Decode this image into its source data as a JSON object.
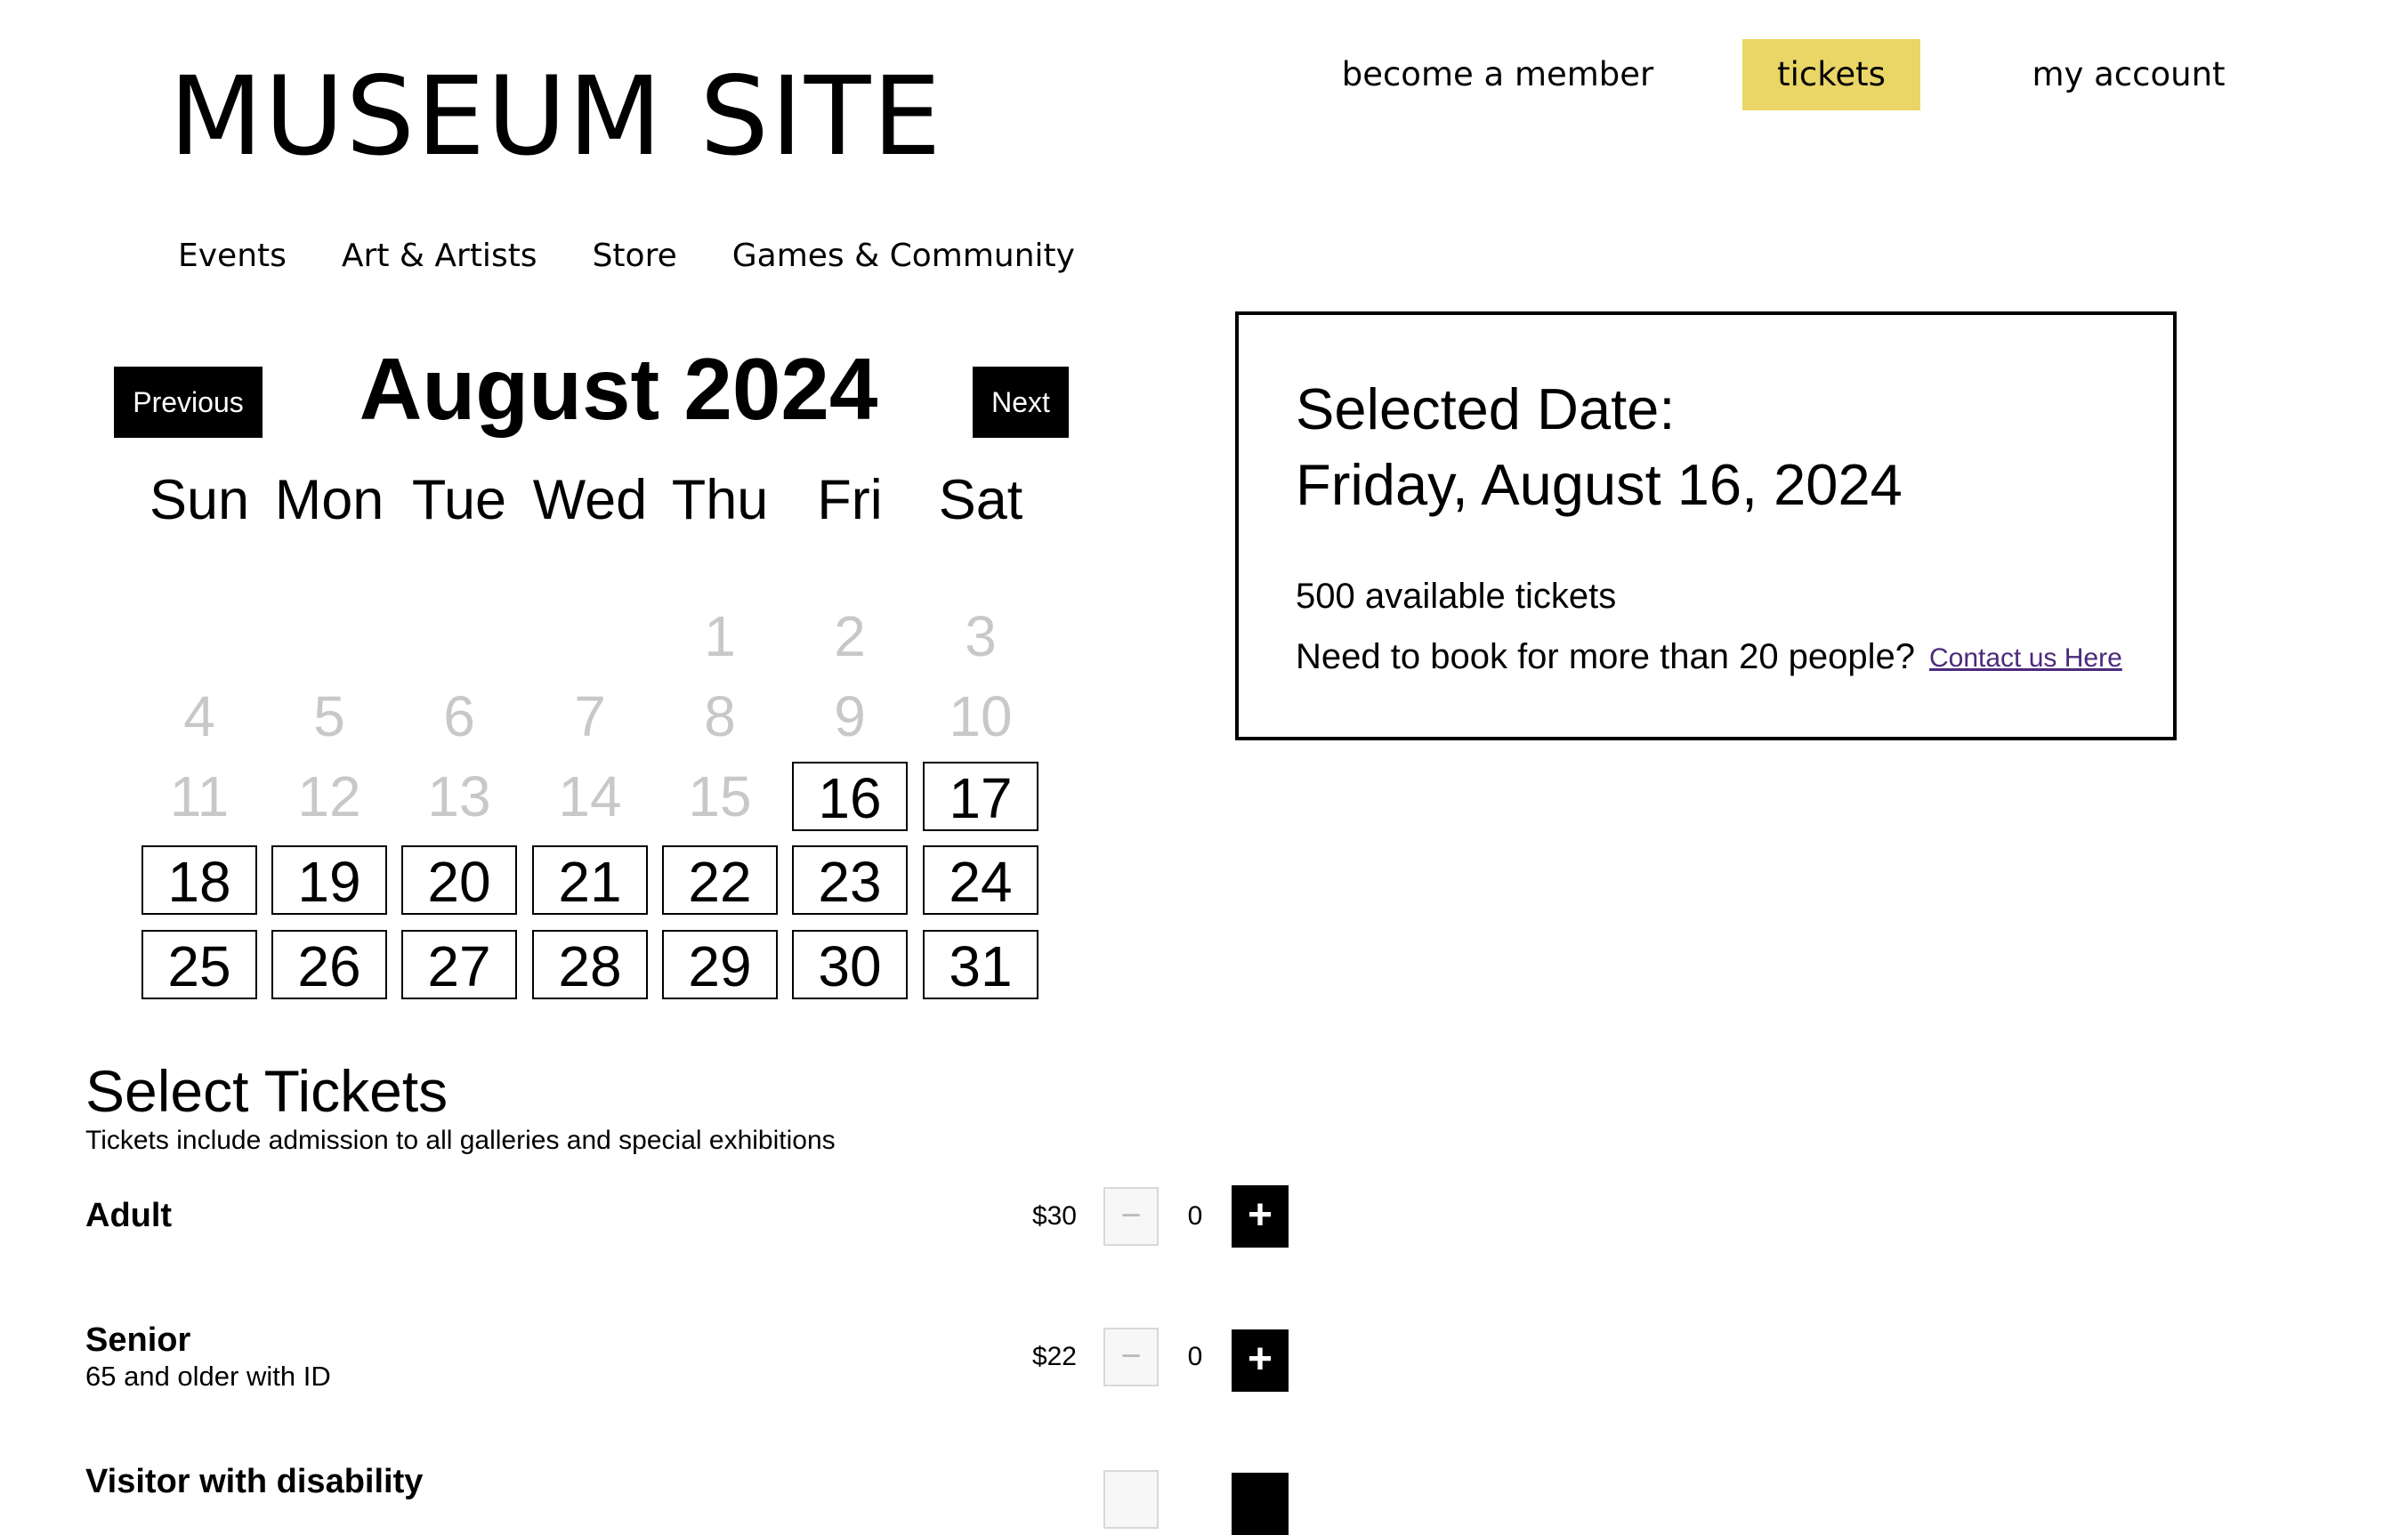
{
  "header": {
    "site_title": "MUSEUM SITE",
    "top_links": {
      "member": "become a member",
      "tickets": "tickets",
      "account": "my account"
    },
    "nav": [
      "Events",
      "Art & Artists",
      "Store",
      "Games & Community"
    ]
  },
  "calendar": {
    "prev_label": "Previous",
    "next_label": "Next",
    "month_title": "August 2024",
    "weekdays": [
      "Sun",
      "Mon",
      "Tue",
      "Wed",
      "Thu",
      "Fri",
      "Sat"
    ],
    "first_weekday_index": 4,
    "days_in_month": 31,
    "first_available_day": 16,
    "selected_day": 16
  },
  "selected_panel": {
    "label": "Selected Date:",
    "date": "Friday, August 16, 2024",
    "availability": "500 available tickets",
    "group_prompt": "Need to book for more than 20 people?",
    "contact_link": "Contact us Here"
  },
  "tickets": {
    "title": "Select Tickets",
    "subtitle": "Tickets include admission to all galleries and special exhibitions",
    "items": [
      {
        "name": "Adult",
        "desc": "",
        "price": "$30",
        "qty": "0",
        "minus": "−",
        "plus": "+"
      },
      {
        "name": "Senior",
        "desc": "65 and older with ID",
        "price": "$22",
        "qty": "0",
        "minus": "−",
        "plus": "+"
      },
      {
        "name": "Visitor with disability",
        "desc": "",
        "price": "",
        "qty": "",
        "minus": "",
        "plus": ""
      }
    ]
  },
  "colors": {
    "accent": "#ead666",
    "link": "#4b2a7a",
    "disabled": "#c8c8c8"
  }
}
